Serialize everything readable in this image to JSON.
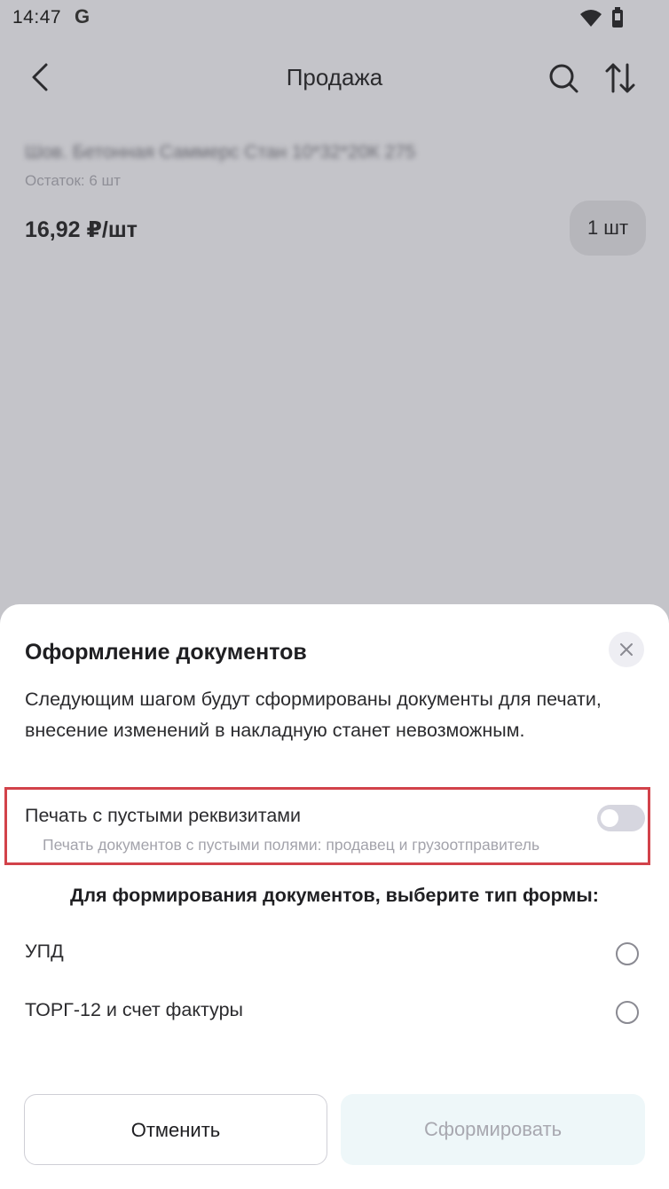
{
  "status_bar": {
    "time": "14:47",
    "g_label": "G"
  },
  "top_bar": {
    "title": "Продажа"
  },
  "product": {
    "name": "Шов. Бетонная Саммерс Стан 10*32*20К 275",
    "stock": "Остаток: 6 шт",
    "price": "16,92 ₽/шт",
    "qty": "1 шт"
  },
  "sheet": {
    "title": "Оформление документов",
    "description": "Следующим шагом будут сформированы документы для печати, внесение изменений в накладную станет невозможным.",
    "print_empty": {
      "label": "Печать с пустыми реквизитами",
      "hint": "Печать документов с пустыми полями: продавец и грузоотправитель",
      "enabled": false
    },
    "form_prompt": "Для формирования документов, выберите тип формы:",
    "options": [
      {
        "label": "УПД",
        "selected": false
      },
      {
        "label": "ТОРГ-12 и счет фактуры",
        "selected": false
      }
    ],
    "buttons": {
      "cancel": "Отменить",
      "submit": "Сформировать"
    }
  },
  "colors": {
    "highlight": "#d2424a",
    "overlay": "#c4c4c9",
    "submit_disabled_bg": "#eef7f9"
  }
}
